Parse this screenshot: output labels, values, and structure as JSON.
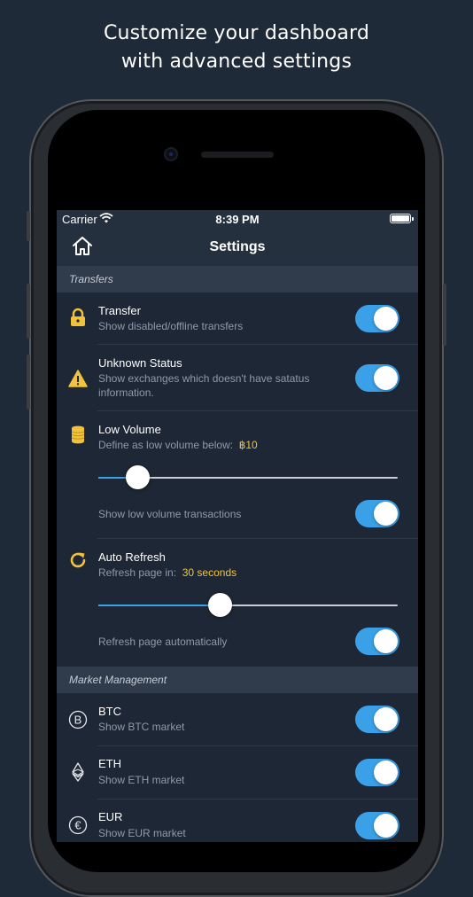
{
  "headline": {
    "line1": "Customize your dashboard",
    "line2": "with advanced settings"
  },
  "statusbar": {
    "carrier": "Carrier",
    "time": "8:39 PM"
  },
  "navbar": {
    "title": "Settings"
  },
  "colors": {
    "accent": "#3aa0e8",
    "gold": "#f1c23a",
    "background": "#1e2a38"
  },
  "sections": {
    "transfers": "Transfers",
    "market": "Market Management"
  },
  "settings": {
    "transfer": {
      "title": "Transfer",
      "subtitle": "Show disabled/offline transfers",
      "icon": "lock-icon",
      "on": true
    },
    "unknown_status": {
      "title": "Unknown Status",
      "subtitle_line1": "Show exchanges which doesn't have satatus",
      "subtitle_line2": "information.",
      "icon": "warning-icon",
      "on": true
    },
    "low_volume": {
      "title": "Low Volume",
      "subtitle": "Define as low volume below:",
      "value": "฿10",
      "slider_fraction": 0.13,
      "toggle_label": "Show low volume transactions",
      "icon": "coin-stack-icon",
      "on": true
    },
    "auto_refresh": {
      "title": "Auto Refresh",
      "subtitle": "Refresh page in:",
      "value": "30 seconds",
      "slider_fraction": 0.406,
      "toggle_label": "Refresh page automatically",
      "icon": "refresh-icon",
      "on": true
    }
  },
  "markets": [
    {
      "title": "BTC",
      "subtitle": "Show BTC market",
      "icon": "bitcoin-icon",
      "on": true
    },
    {
      "title": "ETH",
      "subtitle": "Show ETH market",
      "icon": "ethereum-icon",
      "on": true
    },
    {
      "title": "EUR",
      "subtitle": "Show EUR market",
      "icon": "euro-icon",
      "on": true
    }
  ]
}
